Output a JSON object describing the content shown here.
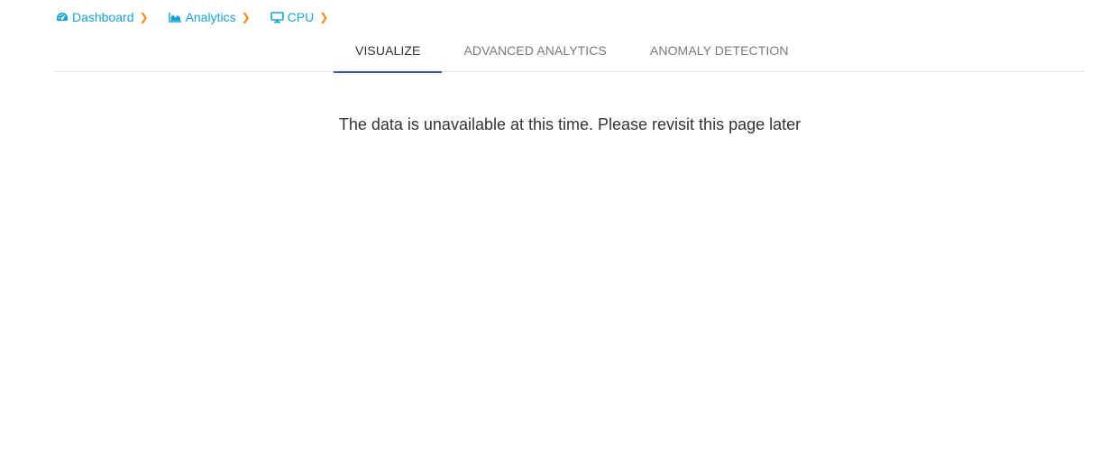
{
  "breadcrumb": {
    "items": [
      {
        "label": "Dashboard",
        "icon": "dashboard-gauge-icon"
      },
      {
        "label": "Analytics",
        "icon": "area-chart-icon"
      },
      {
        "label": "CPU",
        "icon": "monitor-icon"
      }
    ],
    "separator": "❯",
    "link_color": "#1aa3d9",
    "separator_color": "#f28c1a"
  },
  "tabs": {
    "items": [
      {
        "label": "VISUALIZE",
        "active": true
      },
      {
        "label": "ADVANCED ANALYTICS",
        "active": false
      },
      {
        "label": "ANOMALY DETECTION",
        "active": false
      }
    ],
    "active_indicator_color": "#3f51b5"
  },
  "main": {
    "message": "The data is unavailable at this time. Please revisit this page later"
  }
}
